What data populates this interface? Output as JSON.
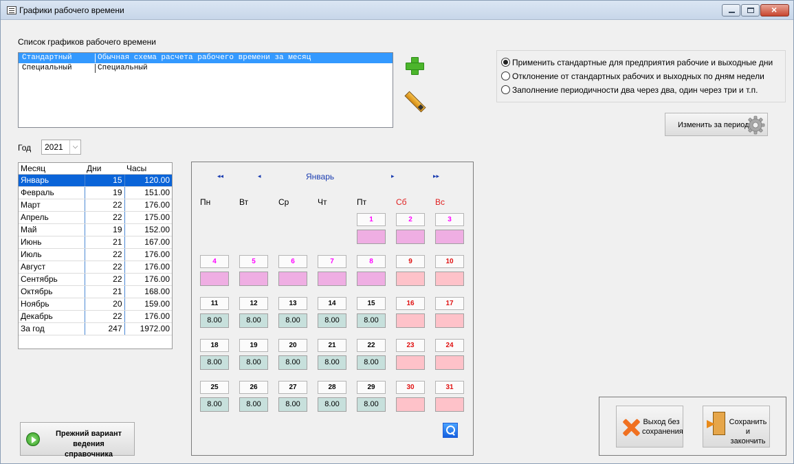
{
  "window": {
    "title": "Графики рабочего времени"
  },
  "schedule_list": {
    "heading": "Список графиков рабочего времени",
    "items": [
      {
        "name": "Стандартный",
        "description": "Обычная схема расчета рабочего времени за месяц",
        "selected": true
      },
      {
        "name": "Специальный",
        "description": "Специальный",
        "selected": false
      }
    ]
  },
  "options": [
    {
      "label": "Применить стандартные для предприятия рабочие и выходные дни",
      "checked": true
    },
    {
      "label": "Отклонение от стандартных рабочих и выходных по дням недели",
      "checked": false
    },
    {
      "label": "Заполнение периодичности два через два, один через три и т.п.",
      "checked": false
    }
  ],
  "change_period_label": "Изменить за период",
  "year": {
    "label": "Год",
    "value": "2021"
  },
  "months_table": {
    "headers": [
      "Месяц",
      "Дни",
      "Часы"
    ],
    "rows": [
      [
        "Январь",
        "15",
        "120.00"
      ],
      [
        "Февраль",
        "19",
        "151.00"
      ],
      [
        "Март",
        "22",
        "176.00"
      ],
      [
        "Апрель",
        "22",
        "175.00"
      ],
      [
        "Май",
        "19",
        "152.00"
      ],
      [
        "Июнь",
        "21",
        "167.00"
      ],
      [
        "Июль",
        "22",
        "176.00"
      ],
      [
        "Август",
        "22",
        "176.00"
      ],
      [
        "Сентябрь",
        "22",
        "176.00"
      ],
      [
        "Октябрь",
        "21",
        "168.00"
      ],
      [
        "Ноябрь",
        "20",
        "159.00"
      ],
      [
        "Декабрь",
        "22",
        "176.00"
      ],
      [
        "За год",
        "247",
        "1972.00"
      ]
    ],
    "selected_index": 0
  },
  "old_variant_label_line1": "Прежний вариант",
  "old_variant_label_line2": "ведения справочника",
  "calendar": {
    "month": "Январь",
    "nav": {
      "first": "◂◂",
      "prev": "◂",
      "next": "▸",
      "last": "▸▸"
    },
    "weekdays": [
      "Пн",
      "Вт",
      "Ср",
      "Чт",
      "Пт",
      "Сб",
      "Вс"
    ],
    "first_weekday_index": 4,
    "days": [
      {
        "d": "1",
        "h": "",
        "t": "cw"
      },
      {
        "d": "2",
        "h": "",
        "t": "cw"
      },
      {
        "d": "3",
        "h": "",
        "t": "cw"
      },
      {
        "d": "4",
        "h": "",
        "t": "cw"
      },
      {
        "d": "5",
        "h": "",
        "t": "cw"
      },
      {
        "d": "6",
        "h": "",
        "t": "cw"
      },
      {
        "d": "7",
        "h": "",
        "t": "cw"
      },
      {
        "d": "8",
        "h": "",
        "t": "cw"
      },
      {
        "d": "9",
        "h": "",
        "t": "ww"
      },
      {
        "d": "10",
        "h": "",
        "t": "ww"
      },
      {
        "d": "11",
        "h": "8.00",
        "t": "nw"
      },
      {
        "d": "12",
        "h": "8.00",
        "t": "nw"
      },
      {
        "d": "13",
        "h": "8.00",
        "t": "nw"
      },
      {
        "d": "14",
        "h": "8.00",
        "t": "nw"
      },
      {
        "d": "15",
        "h": "8.00",
        "t": "nw"
      },
      {
        "d": "16",
        "h": "",
        "t": "ww"
      },
      {
        "d": "17",
        "h": "",
        "t": "ww"
      },
      {
        "d": "18",
        "h": "8.00",
        "t": "nw"
      },
      {
        "d": "19",
        "h": "8.00",
        "t": "nw"
      },
      {
        "d": "20",
        "h": "8.00",
        "t": "nw"
      },
      {
        "d": "21",
        "h": "8.00",
        "t": "nw"
      },
      {
        "d": "22",
        "h": "8.00",
        "t": "nw"
      },
      {
        "d": "23",
        "h": "",
        "t": "ww"
      },
      {
        "d": "24",
        "h": "",
        "t": "ww"
      },
      {
        "d": "25",
        "h": "8.00",
        "t": "nw"
      },
      {
        "d": "26",
        "h": "8.00",
        "t": "nw"
      },
      {
        "d": "27",
        "h": "8.00",
        "t": "nw"
      },
      {
        "d": "28",
        "h": "8.00",
        "t": "nw"
      },
      {
        "d": "29",
        "h": "8.00",
        "t": "nw"
      },
      {
        "d": "30",
        "h": "",
        "t": "ww"
      },
      {
        "d": "31",
        "h": "",
        "t": "ww"
      }
    ]
  },
  "exit_label_line1": "Выход без",
  "exit_label_line2": "сохранения",
  "save_label_line1": "Сохранить и",
  "save_label_line2": "закончить",
  "colors": {
    "holiday": "#efaee3",
    "weekend": "#fec2c9",
    "workday": "#c7e0dc",
    "selection": "#3399ff"
  },
  "icons": [
    "app-window-icon",
    "add-icon",
    "pencil-icon",
    "gear-icon",
    "play-icon",
    "zoom-icon",
    "close-x-icon",
    "exit-door-icon"
  ]
}
